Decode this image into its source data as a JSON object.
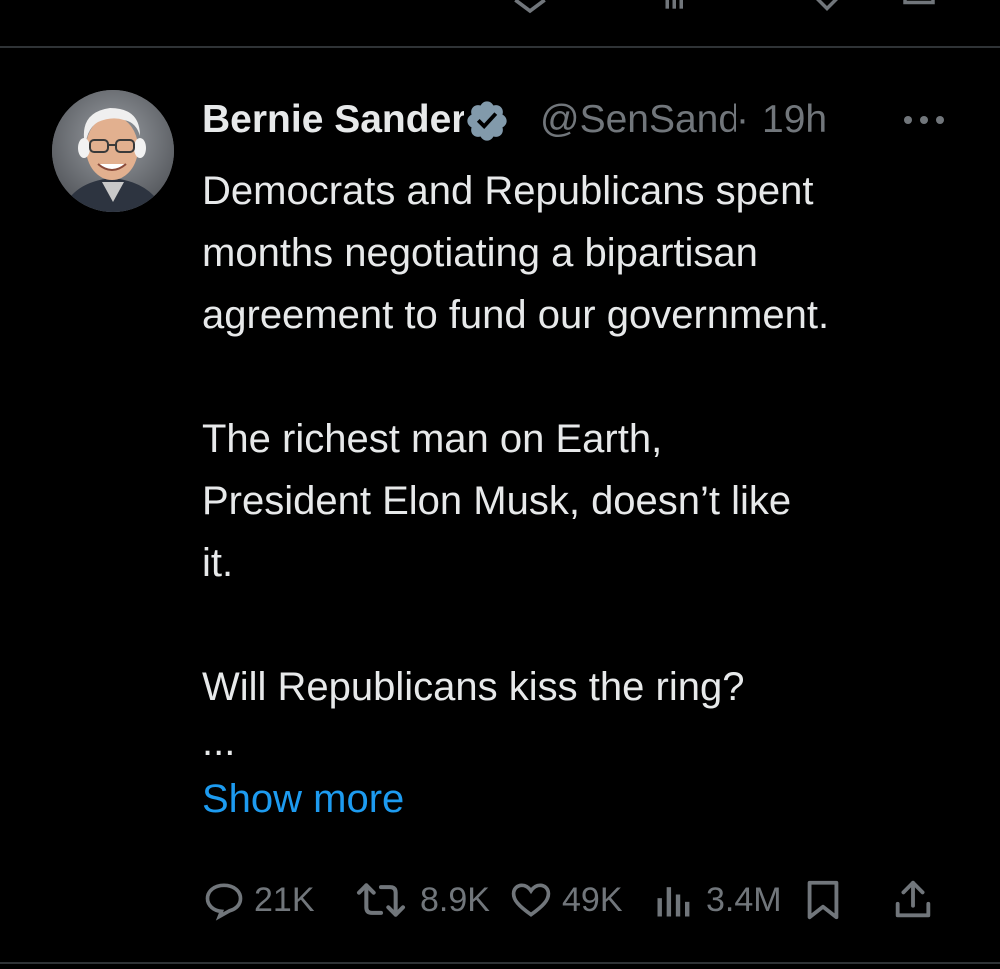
{
  "tweet": {
    "author_name": "Bernie Sanders",
    "handle": "@SenSanders",
    "separator": "·",
    "time": "19h",
    "paragraph_1": "Democrats and Republicans spent\nmonths negotiating a bipartisan\nagreement to fund our government.",
    "paragraph_2": "The richest man on Earth,\nPresident Elon Musk, doesn’t like\nit.",
    "paragraph_3": "Will Republicans kiss the ring?",
    "ellipsis": "...",
    "show_more": "Show more"
  },
  "actions": {
    "replies": "21K",
    "reposts": "8.9K",
    "likes": "49K",
    "views": "3.4M"
  },
  "icons": {
    "verified": "verified-badge-icon",
    "more": "more-icon",
    "reply": "reply-icon",
    "repost": "repost-icon",
    "like": "like-icon",
    "views": "views-icon",
    "bookmark": "bookmark-icon",
    "share": "share-icon"
  },
  "colors": {
    "background": "#000000",
    "text_primary": "#e7e9ea",
    "text_secondary": "#71767b",
    "link_blue": "#1d9bf0",
    "divider": "#2f3336",
    "verified_badge": "#829aab"
  }
}
